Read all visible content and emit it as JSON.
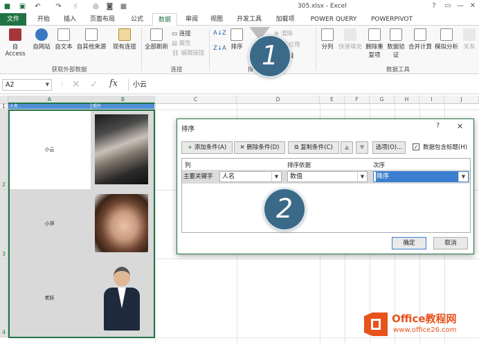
{
  "window": {
    "title": "305.xlsx - Excel",
    "help": "?",
    "buttons": {
      "minimize": "—",
      "restore": "▫",
      "close": "✕"
    }
  },
  "tabs": [
    "文件",
    "开始",
    "插入",
    "页面布局",
    "公式",
    "数据",
    "审阅",
    "视图",
    "开发工具",
    "加载项",
    "POWER QUERY",
    "POWERPIVOT"
  ],
  "active_tab": "数据",
  "ribbon": {
    "get_external": {
      "group": "获取外部数据",
      "items": [
        "自 Access",
        "自网站",
        "自文本",
        "自其他来源",
        "现有连接"
      ]
    },
    "connections": {
      "group": "连接",
      "refresh_all": "全部刷新",
      "items": [
        "连接",
        "属性",
        "编辑链接"
      ]
    },
    "sort_filter": {
      "group": "排",
      "sort_az": "A↓Z",
      "sort_za": "Z↓A",
      "sort": "排序",
      "items": [
        "清除",
        "新应用",
        "级"
      ]
    },
    "data_tools": {
      "group": "数据工具",
      "items": [
        "分列",
        "快速填充",
        "删除重复项",
        "数据验证",
        "合并计算",
        "模拟分析",
        "关系"
      ]
    }
  },
  "formula_bar": {
    "name_box": "A2",
    "fx": "fx",
    "value": "小云"
  },
  "sheet": {
    "columns": [
      "A",
      "B",
      "C",
      "D",
      "E",
      "F",
      "G",
      "H",
      "I",
      "J"
    ],
    "rows": [
      "1",
      "2",
      "3",
      "4"
    ],
    "header_row": [
      "人名",
      "照片"
    ],
    "names": [
      "小云",
      "小萍",
      "老妖"
    ]
  },
  "dialog": {
    "title": "排序",
    "help": "?",
    "close": "✕",
    "toolbar": {
      "add": "添加条件(A)",
      "delete": "删除条件(D)",
      "copy": "复制条件(C)",
      "options": "选项(O)...",
      "header_checkbox": "数据包含标题(H)",
      "header_checked": true
    },
    "columns": {
      "column": "列",
      "sort_on": "排序依据",
      "order": "次序"
    },
    "row": {
      "label": "主要关键字",
      "column_value": "人名",
      "sort_on_value": "数值",
      "order_value": "降序"
    },
    "ok": "确定",
    "cancel": "取消"
  },
  "badges": [
    "1",
    "2"
  ],
  "watermark": {
    "brand": "Office教程网",
    "url": "www.office26.com"
  }
}
